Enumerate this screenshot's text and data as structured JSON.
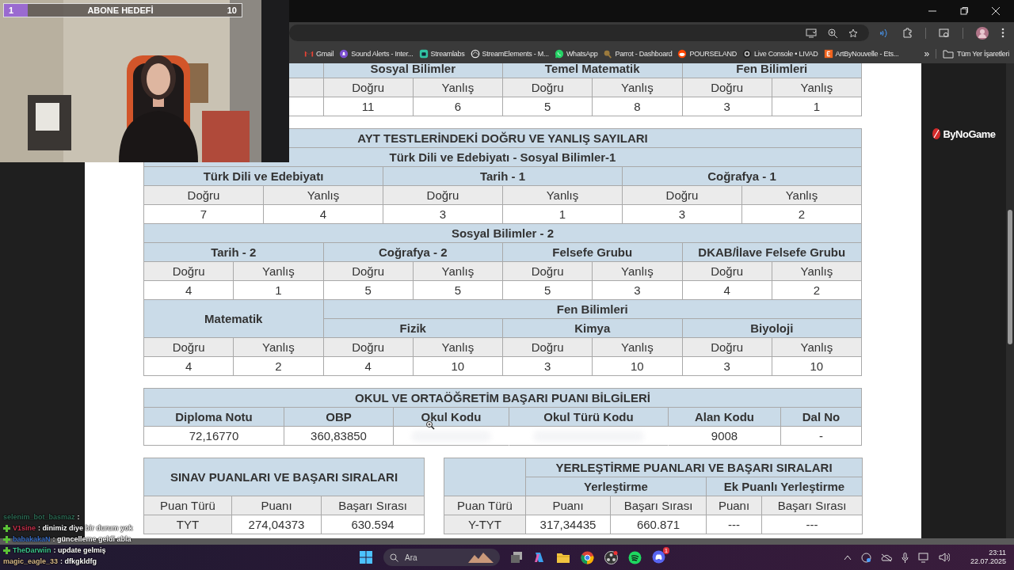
{
  "stream_overlay": {
    "goal": {
      "current": "1",
      "title": "ABONE HEDEFİ",
      "target": "10",
      "level": 0.1
    }
  },
  "browser": {
    "bookmarks": [
      {
        "label": "Gmail"
      },
      {
        "label": "Sound Alerts - Inter..."
      },
      {
        "label": "Streamlabs"
      },
      {
        "label": "StreamElements - M..."
      },
      {
        "label": "WhatsApp"
      },
      {
        "label": "Parrot - Dashboard"
      },
      {
        "label": "POURSELAND"
      },
      {
        "label": "Live Console • LIVAD"
      },
      {
        "label": "ArtByNouvelle - Ets..."
      }
    ],
    "more": "»",
    "all_bookmarks": "Tüm Yer İşaretleri"
  },
  "page": {
    "tyt_counts": {
      "groups": [
        {
          "name": "Sosyal Bilimler",
          "columns": [
            {
              "label": "Doğru",
              "value": "11"
            },
            {
              "label": "Yanlış",
              "value": "6"
            }
          ]
        },
        {
          "name": "Temel Matematik",
          "columns": [
            {
              "label": "Doğru",
              "value": "5"
            },
            {
              "label": "Yanlış",
              "value": "8"
            }
          ]
        },
        {
          "name": "Fen Bilimleri",
          "columns": [
            {
              "label": "Doğru",
              "value": "3"
            },
            {
              "label": "Yanlış",
              "value": "1"
            }
          ]
        }
      ]
    },
    "ayt_counts": {
      "title": "AYT TESTLERİNDEKİ DOĞRU VE YANLIŞ SAYILARI",
      "sections": [
        {
          "name": "Türk Dili ve Edebiyatı - Sosyal Bilimler-1",
          "groups": [
            {
              "name": "Türk Dili ve Edebiyatı",
              "columns": [
                {
                  "label": "Doğru",
                  "value": "7"
                },
                {
                  "label": "Yanlış",
                  "value": "4"
                }
              ]
            },
            {
              "name": "Tarih - 1",
              "columns": [
                {
                  "label": "Doğru",
                  "value": "3"
                },
                {
                  "label": "Yanlış",
                  "value": "1"
                }
              ]
            },
            {
              "name": "Coğrafya - 1",
              "columns": [
                {
                  "label": "Doğru",
                  "value": "3"
                },
                {
                  "label": "Yanlış",
                  "value": "2"
                }
              ]
            }
          ]
        },
        {
          "name": "Sosyal Bilimler - 2",
          "groups": [
            {
              "name": "Tarih - 2",
              "columns": [
                {
                  "label": "Doğru",
                  "value": "4"
                },
                {
                  "label": "Yanlış",
                  "value": "1"
                }
              ]
            },
            {
              "name": "Coğrafya - 2",
              "columns": [
                {
                  "label": "Doğru",
                  "value": "5"
                },
                {
                  "label": "Yanlış",
                  "value": "5"
                }
              ]
            },
            {
              "name": "Felsefe Grubu",
              "columns": [
                {
                  "label": "Doğru",
                  "value": "5"
                },
                {
                  "label": "Yanlış",
                  "value": "3"
                }
              ]
            },
            {
              "name": "DKAB/İlave Felsefe Grubu",
              "columns": [
                {
                  "label": "Doğru",
                  "value": "4"
                },
                {
                  "label": "Yanlış",
                  "value": "2"
                }
              ]
            }
          ]
        },
        {
          "groups": [
            {
              "name": "Matematik",
              "columns": [
                {
                  "label": "Doğru",
                  "value": "4"
                },
                {
                  "label": "Yanlış",
                  "value": "2"
                }
              ]
            },
            {
              "name": "Fen Bilimleri",
              "subgroups": [
                {
                  "name": "Fizik",
                  "columns": [
                    {
                      "label": "Doğru",
                      "value": "4"
                    },
                    {
                      "label": "Yanlış",
                      "value": "10"
                    }
                  ]
                },
                {
                  "name": "Kimya",
                  "columns": [
                    {
                      "label": "Doğru",
                      "value": "3"
                    },
                    {
                      "label": "Yanlış",
                      "value": "10"
                    }
                  ]
                },
                {
                  "name": "Biyoloji",
                  "columns": [
                    {
                      "label": "Doğru",
                      "value": "3"
                    },
                    {
                      "label": "Yanlış",
                      "value": "10"
                    }
                  ]
                }
              ]
            }
          ]
        }
      ]
    },
    "school": {
      "title": "OKUL VE ORTAÖĞRETİM BAŞARI PUANI BİLGİLERİ",
      "columns": [
        {
          "label": "Diploma Notu",
          "value": "72,16770",
          "redacted": false
        },
        {
          "label": "OBP",
          "value": "360,83850",
          "redacted": false
        },
        {
          "label": "Okul Kodu",
          "redacted": true
        },
        {
          "label": "Okul Türü Kodu",
          "redacted": true
        },
        {
          "label": "Alan Kodu",
          "value": "9008",
          "redacted": false
        },
        {
          "label": "Dal No",
          "value": "-",
          "redacted": false
        }
      ]
    },
    "exam_scores": {
      "title": "SINAV PUANLARI VE BAŞARI SIRALARI",
      "row_header": "Puan Türü",
      "columns": [
        "Puanı",
        "Başarı Sırası"
      ],
      "rows": [
        {
          "label": "TYT",
          "values": [
            "274,04373",
            "630.594"
          ]
        }
      ]
    },
    "placement_scores": {
      "title": "YERLEŞTİRME PUANLARI VE BAŞARI SIRALARI",
      "row_header": "Puan Türü",
      "groups": [
        {
          "name": "Yerleştirme",
          "columns": [
            "Puanı",
            "Başarı Sırası"
          ]
        },
        {
          "name": "Ek Puanlı Yerleştirme",
          "columns": [
            "Puanı",
            "Başarı Sırası"
          ]
        }
      ],
      "rows": [
        {
          "label": "Y-TYT",
          "values": [
            "317,34435",
            "660.871",
            "---",
            "---"
          ]
        }
      ]
    }
  },
  "ad": {
    "logo": "ByNoGame"
  },
  "chat": [
    {
      "user": "selenim_bot_basmaz",
      "message": ":",
      "color": "#2f6b55",
      "badge": false
    },
    {
      "user": "V1sine",
      "message": ": dinimiz diye bir durum yok",
      "color": "#c8324e",
      "badge": true
    },
    {
      "user": "babakakaN",
      "message": ": güncelleme geldi abla",
      "color": "#3b6fc6",
      "badge": true
    },
    {
      "user": "TheDarwiin",
      "message": ": update gelmiş",
      "color": "#3cc48c",
      "badge": true
    },
    {
      "user": "magic_eagle_33",
      "message": ": dfkgkldfg",
      "color": "#d8b98a",
      "badge": false
    }
  ],
  "taskbar": {
    "search_placeholder": "Ara",
    "discord_badge": "1",
    "time": "23:11",
    "date": "22.07.2025"
  }
}
